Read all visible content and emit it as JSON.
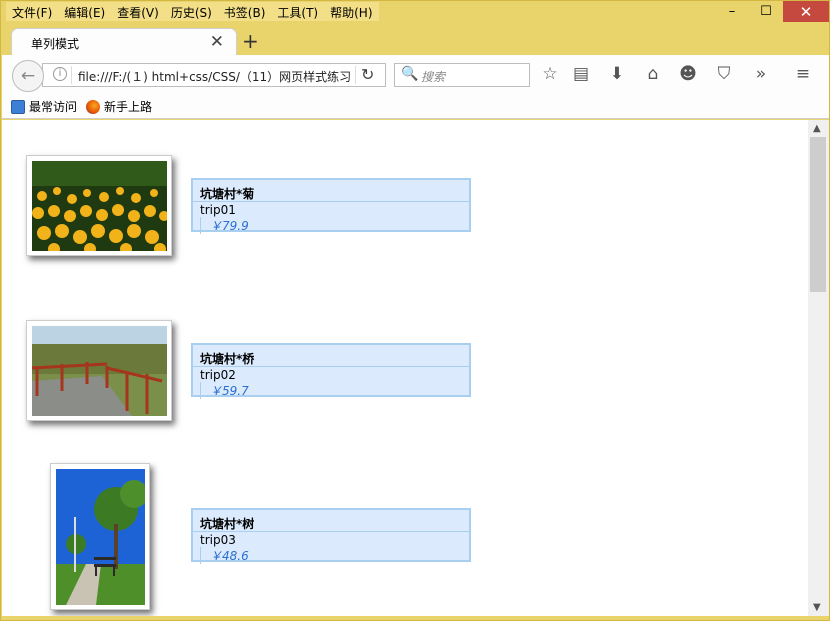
{
  "menu": [
    "文件(F)",
    "编辑(E)",
    "查看(V)",
    "历史(S)",
    "书签(B)",
    "工具(T)",
    "帮助(H)"
  ],
  "window_controls": {
    "minimize": "–",
    "maximize": "☐",
    "close": "✕"
  },
  "tab": {
    "title": "单列模式",
    "close": "✕",
    "new_tab": "+"
  },
  "navbar": {
    "back_icon": "←",
    "url": "file:///F:/(１) html+css/CSS/（11）网页样式练习",
    "reload_icon": "↻",
    "search_placeholder": "搜索",
    "search_icon": "🔍",
    "tools": [
      "☆",
      "▤",
      "⬇",
      "⌂",
      "☻",
      "⛉",
      "»",
      "≡"
    ]
  },
  "bookmarks": [
    {
      "label": "最常访问",
      "icon": "most-visited-icon"
    },
    {
      "label": "新手上路",
      "icon": "firefox-icon"
    }
  ],
  "items": [
    {
      "name": "坑塘村*菊",
      "code": "trip01",
      "price": "￥79.9",
      "image": "yellow-flowers"
    },
    {
      "name": "坑塘村*桥",
      "code": "trip02",
      "price": "￥59.7",
      "image": "wooden-bridge"
    },
    {
      "name": "坑塘村*树",
      "code": "trip03",
      "price": "￥48.6",
      "image": "park-trees"
    }
  ],
  "colors": {
    "chrome": "#e9d36b",
    "card_bg": "#dbeafc",
    "card_border": "#a9cff0",
    "price": "#2a6fd1",
    "close_btn": "#c6493f"
  }
}
